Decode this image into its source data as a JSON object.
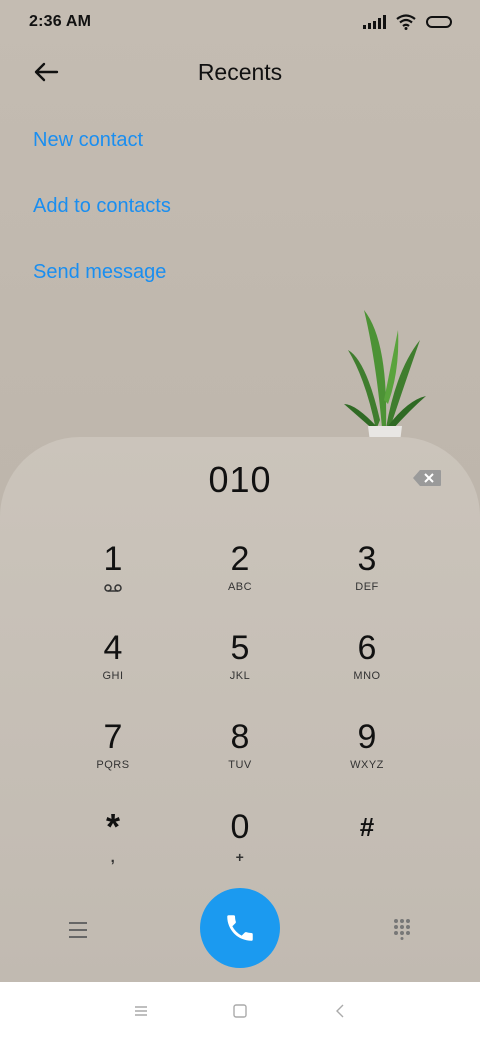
{
  "status": {
    "time": "2:36 AM",
    "icons": [
      "signal-icon",
      "wifi-icon",
      "battery-icon"
    ]
  },
  "header": {
    "title": "Recents",
    "back_icon": "back-arrow-icon"
  },
  "actions": [
    {
      "label": "New contact"
    },
    {
      "label": "Add to contacts"
    },
    {
      "label": "Send message"
    }
  ],
  "dialpad": {
    "number": "010",
    "keys": [
      {
        "digit": "1",
        "letters": "",
        "icon": "voicemail-icon"
      },
      {
        "digit": "2",
        "letters": "ABC"
      },
      {
        "digit": "3",
        "letters": "DEF"
      },
      {
        "digit": "4",
        "letters": "GHI"
      },
      {
        "digit": "5",
        "letters": "JKL"
      },
      {
        "digit": "6",
        "letters": "MNO"
      },
      {
        "digit": "7",
        "letters": "PQRS"
      },
      {
        "digit": "8",
        "letters": "TUV"
      },
      {
        "digit": "9",
        "letters": "WXYZ"
      },
      {
        "digit": "*",
        "letters": ","
      },
      {
        "digit": "0",
        "letters": "+"
      },
      {
        "digit": "#",
        "letters": ""
      }
    ]
  },
  "colors": {
    "accent": "#1a8ef0",
    "call_button": "#1b9af0",
    "background": "#c4bcb2"
  }
}
